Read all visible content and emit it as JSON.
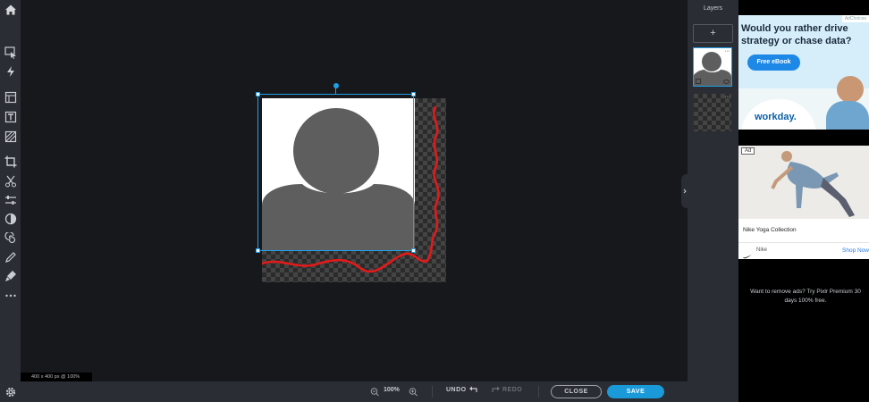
{
  "toolbar": {
    "tools": [
      "home-icon",
      "arrange-icon",
      "quick-edit-icon",
      "layout-icon",
      "text-icon",
      "fill-icon",
      "crop-icon",
      "cutout-icon",
      "adjust-icon",
      "filter-icon",
      "liquify-icon",
      "draw-icon",
      "retouch-icon",
      "more-icon",
      "settings-icon"
    ]
  },
  "canvas": {
    "size_label": "400 x 400 px @ 100%"
  },
  "bottom": {
    "zoom": "100%",
    "undo": "UNDO",
    "redo": "REDO",
    "close": "CLOSE",
    "save": "SAVE"
  },
  "layers": {
    "title": "Layers",
    "add": "+",
    "more": "···"
  },
  "ad1": {
    "choices": "AdChoices",
    "headline": "Would you rather drive strategy or chase data?",
    "cta": "Free eBook",
    "brand": "workday."
  },
  "ad2": {
    "badge": "Ad",
    "title": "Nike Yoga Collection",
    "advertiser": "Nike",
    "cta": "Shop Now"
  },
  "promo": {
    "text": "Want to remove ads? Try Pixlr Premium 30 days 100% free."
  },
  "colors": {
    "accent": "#1fa0e6",
    "save": "#1a9ad9"
  }
}
